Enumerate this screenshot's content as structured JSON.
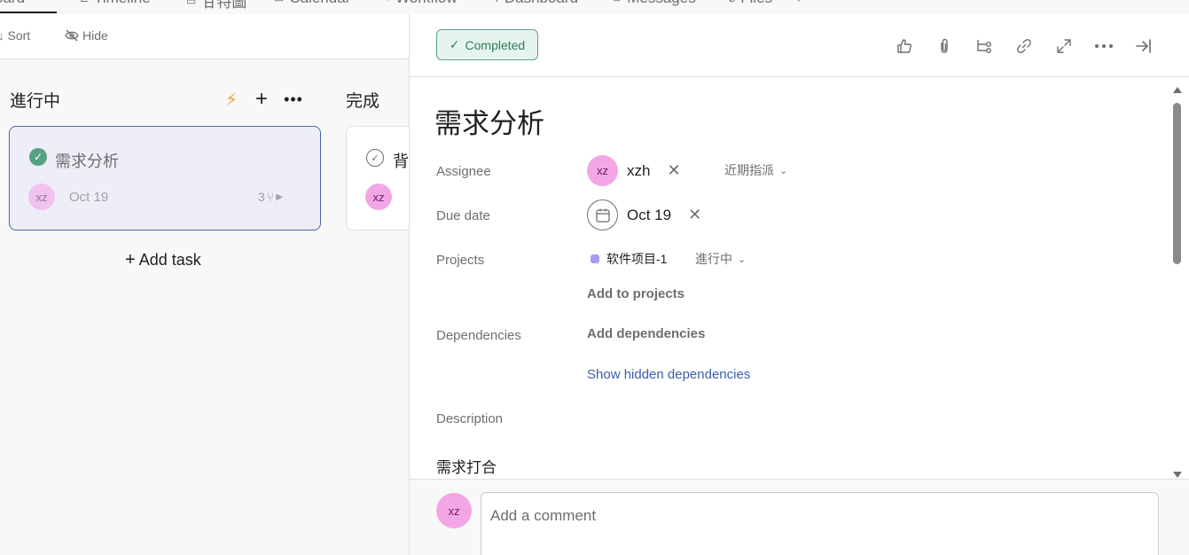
{
  "tabs": [
    {
      "label": "oard",
      "icon": "board-icon"
    },
    {
      "label": "Timeline",
      "icon": "timeline-icon"
    },
    {
      "label": "甘特圖",
      "icon": "gantt-icon"
    },
    {
      "label": "Calendar",
      "icon": "calendar-icon"
    },
    {
      "label": "Workflow",
      "icon": "workflow-icon"
    },
    {
      "label": "Dashboard",
      "icon": "dashboard-icon"
    },
    {
      "label": "Messages",
      "icon": "messages-icon"
    },
    {
      "label": "Files",
      "icon": "files-icon"
    },
    {
      "label": "+",
      "icon": "plus-icon"
    }
  ],
  "toolbar": {
    "sort_label": "Sort",
    "hide_label": "Hide"
  },
  "board": {
    "columns": [
      {
        "title": "進行中"
      },
      {
        "title": "完成"
      }
    ],
    "card1": {
      "title": "需求分析",
      "avatar": "xz",
      "date": "Oct 19",
      "subtasks": "3"
    },
    "card2": {
      "title": "背",
      "avatar": "xz"
    },
    "add_task": "Add task"
  },
  "detail": {
    "completed_label": "Completed",
    "title": "需求分析",
    "assignee_label": "Assignee",
    "assignee_avatar": "xz",
    "assignee_name": "xzh",
    "assignee_section": "近期指派",
    "due_label": "Due date",
    "due_value": "Oct 19",
    "projects_label": "Projects",
    "project_name": "软件项目-1",
    "project_section": "進行中",
    "project_color": "#a89af0",
    "add_to_projects": "Add to projects",
    "dependencies_label": "Dependencies",
    "add_dependencies": "Add dependencies",
    "show_hidden": "Show hidden dependencies",
    "description_label": "Description",
    "description_text": "需求打合"
  },
  "comment": {
    "avatar": "xz",
    "placeholder": "Add a comment"
  }
}
